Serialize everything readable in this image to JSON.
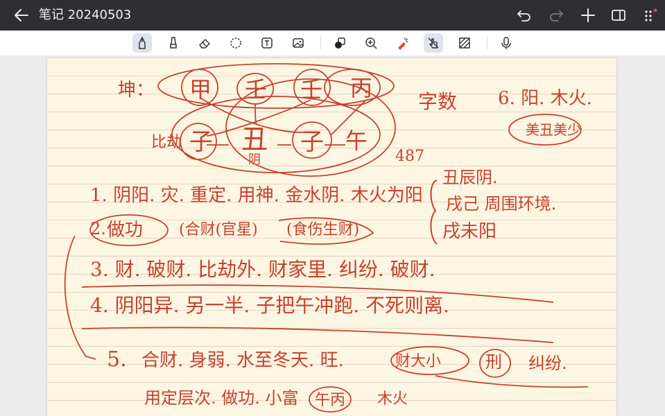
{
  "window": {
    "title": "笔记 20240503"
  },
  "title_actions": [
    {
      "name": "undo-icon"
    },
    {
      "name": "redo-icon"
    },
    {
      "name": "add-icon"
    },
    {
      "name": "sidebar-icon"
    },
    {
      "name": "more-icon"
    }
  ],
  "toolbar": {
    "tools": [
      {
        "name": "pen-icon",
        "active": true
      },
      {
        "name": "highlighter-icon",
        "active": false
      },
      {
        "name": "eraser-icon",
        "active": false
      },
      {
        "name": "lasso-icon",
        "active": false
      },
      {
        "name": "text-box-icon",
        "active": false
      },
      {
        "name": "image-icon",
        "active": false
      },
      {
        "name": "shape-icon",
        "active": false
      },
      {
        "name": "zoom-icon",
        "active": false
      },
      {
        "name": "laser-pointer-icon",
        "active": false
      },
      {
        "name": "touch-draw-icon",
        "active": true
      },
      {
        "name": "paper-pattern-icon",
        "active": false
      },
      {
        "name": "microphone-icon",
        "active": false
      }
    ]
  },
  "note": {
    "ink_color": "#c8402f",
    "lines": {
      "r1_a": "坤：",
      "r1_b": "甲",
      "r1_c": "壬",
      "r1_d": "壬",
      "r1_e": "丙",
      "r1_f": "字数",
      "r1_g": "6. 阳. 木火.",
      "r2_a": "比劫",
      "r2_b": "子",
      "r2_c": "丑",
      "r2_d": "子",
      "r2_e": "午",
      "r2_f": "阴",
      "r2_g": "美丑美少",
      "r2_h": "487",
      "l1": "1. 阴阳. 灾. 重定. 用神. 金水阴. 木火为阳",
      "l1_side_a": "丑辰阴.",
      "l1_side_b": "戌己 周围环境.",
      "l1_side_c": "戌未阳",
      "l2_a": "2.",
      "l2_b": "做功",
      "l2_c": "(合财(官星)",
      "l2_d": "(食伤生财)",
      "l3": "3. 财. 破财. 比劫外. 财家里. 纠纷. 破财.",
      "l4": "4. 阴阳异. 另一半. 子把午冲跑. 不死则离.",
      "l5_a": "5.",
      "l5_b": "合财. 身弱. 水至冬天. 旺.",
      "l5_c": "财大小",
      "l5_d": "刑",
      "l5_e": "纠纷.",
      "l6_a": "用定层次. 做功. 小富",
      "l6_b": "午丙",
      "l6_c": "木火"
    }
  }
}
